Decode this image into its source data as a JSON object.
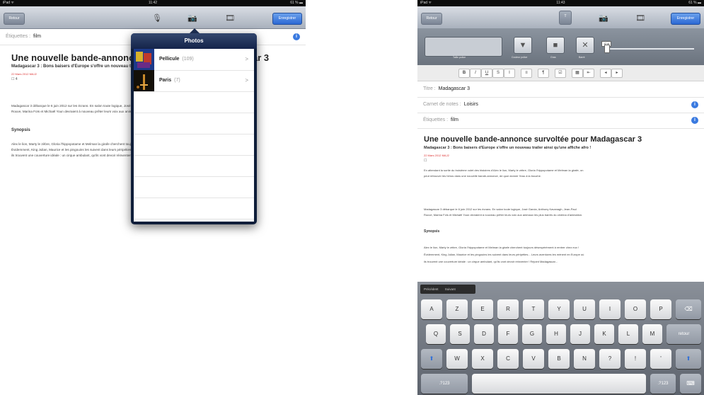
{
  "left": {
    "status": {
      "carrier": "iPad ᯤ",
      "time": "11:42",
      "battery": "61 % ▬"
    },
    "toolbar": {
      "back_label": "Retour",
      "save_label": "Enregistrer"
    },
    "tags": {
      "label": "Étiquettes :",
      "value": "film"
    },
    "article": {
      "title": "Une nouvelle bande-annonce survoltée pour Madagascar 3",
      "subtitle": "Madagascar 3 : Bons baisers d'Europe s'offre un nouveau trailer ainsi qu'une affiche afro !",
      "date": "22 Mars 2012 MAJ2",
      "misc": "☐ 4",
      "para1": "Madagascar 3 débarque le 6 juin 2012 sur les écrans. En salon toute logique, José Garcia, Anthony Kavanagh, Jean-Paul",
      "para1b": "Rouve, Marina Foïs et Michaël Youn devraient à nouveau prêter leurs voix aux animaux les plus barrés du cinéma d'animation.",
      "heading": "Synopsis",
      "para2": "Alex le lion, Marty le zèbre, Gloria l'hippopotame et Melman la girafe cherchent toujours désespérément à rentrer chez eux !",
      "para2b": "Évidemment, King Julian, Maurice et les pingouins les suivent dans leurs péripéties... Leurs aventures les mènent en Europe où",
      "para2c": "ils trouvent une couverture idéale : un cirque ambulant, qu'ils vont devoir réinventer ! Rejoint Madagascar..."
    },
    "popover": {
      "title": "Photos",
      "rows": [
        {
          "name": "Pellicule",
          "count": "(109)"
        },
        {
          "name": "Paris",
          "count": "(7)"
        }
      ]
    }
  },
  "right": {
    "status": {
      "carrier": "iPad ᯤ",
      "time": "11:43",
      "battery": "61 % ▬"
    },
    "toolbar": {
      "back_label": "Retour",
      "save_label": "Enregistrer"
    },
    "format_labels": {
      "size": "Taille police",
      "style": "Couleur police",
      "bold": "Gras",
      "strike": "Barré"
    },
    "slider_tag": "12 pt",
    "fields": {
      "title_label": "Titre :",
      "title_value": "Madagascar 3",
      "notebook_label": "Carnet de notes :",
      "notebook_value": "Loisirs",
      "tags_label": "Étiquettes :",
      "tags_value": "film"
    },
    "article": {
      "title": "Une nouvelle bande-annonce survoltée pour Madagascar 3",
      "subtitle": "Madagascar 3 : Bons baisers d'Europe s'offre un nouveau trailer ainsi qu'une affiche afro !",
      "date": "22 Mars 2012 MAJ2",
      "misc": "☐",
      "intro1": "En attendant la sortie du troisième volet des histoires d'Alex le lion, Marty le zèbre, Gloria l'hippopotame et Melman la girafe, on",
      "intro2": "peut retrouver les héros dans une nouvelle bande-annonce, de quoi donner l'eau à la bouche.",
      "para1": "Madagascar 3 débarque le 6 juin 2012 sur les écrans. En salon toute logique, José Garcia, Anthony Kavanagh, Jean-Paul",
      "para1b": "Rouve, Marina Foïs et Michaël Youn devraient à nouveau prêter leurs voix aux animaux les plus barrés du cinéma d'animation.",
      "heading": "Synopsis",
      "para2": "Alex le lion, Marty le zèbre, Gloria l'hippopotame et Melman la girafe cherchent toujours désespérément à rentrer chez eux !",
      "para2b": "Évidemment, King Julian, Maurice et les pingouins les suivent dans leurs péripéties... Leurs aventures les mènent en Europe où",
      "para2c": "ils trouvent une couverture idéale : un cirque ambulant, qu'ils vont devoir réinventer ! Rejoint Madagascar..."
    },
    "keyboard": {
      "suggest1": "Précédent",
      "suggest2": "Suivant",
      "row1": [
        "A",
        "Z",
        "E",
        "R",
        "T",
        "Y",
        "U",
        "I",
        "O",
        "P"
      ],
      "row2": [
        "Q",
        "S",
        "D",
        "F",
        "G",
        "H",
        "J",
        "K",
        "L",
        "M"
      ],
      "row3": [
        "W",
        "X",
        "C",
        "V",
        "B",
        "N",
        "?",
        "!",
        "'"
      ],
      "backspace": "⌫",
      "return": "retour",
      "shift": "⬆",
      "numbers": ".?123",
      "hide": "⌨"
    }
  }
}
